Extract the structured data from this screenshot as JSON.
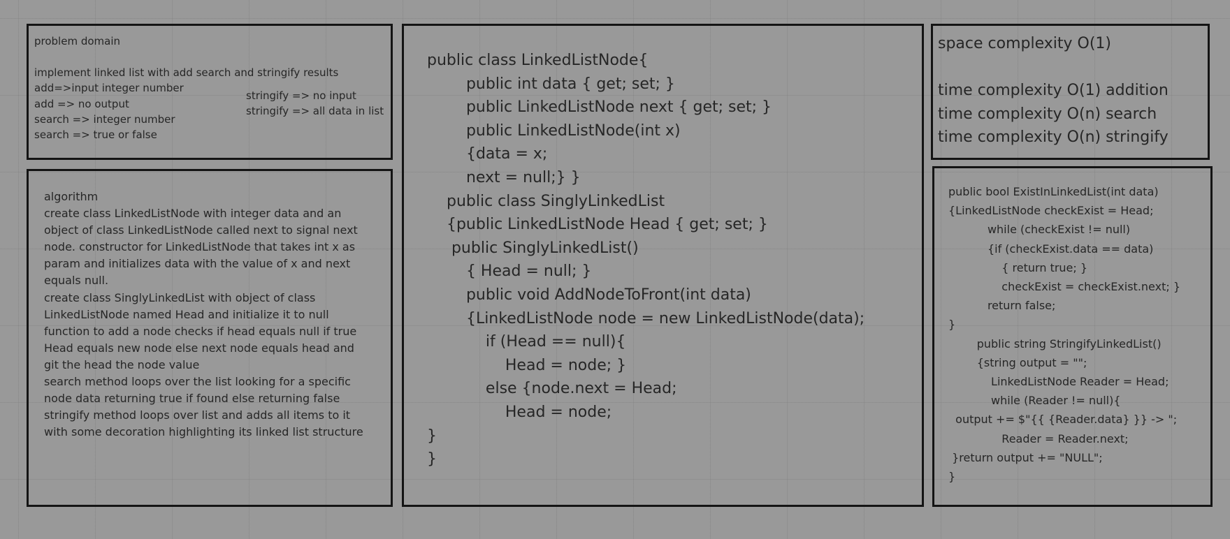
{
  "problem_domain": {
    "lines": [
      "problem domain",
      "",
      "implement linked list with add search and stringify results",
      "add=>input integer number",
      "add => no output",
      "search => integer number",
      "search => true or false"
    ],
    "right_lines": [
      "stringify => no input",
      "stringify => all data in list"
    ]
  },
  "algorithm": {
    "lines": [
      "algorithm",
      "create class LinkedListNode with integer data and an",
      "object of class LinkedListNode called next to signal next",
      "node. constructor for LinkedListNode that takes int x as",
      "param and initializes data with the value of x and next",
      "equals null.",
      "create class SinglyLinkedList with object of class",
      "LinkedListNode named Head and initialize it to null",
      "function to add a node checks if head equals null if true",
      "Head equals new node else next node equals head and",
      "git the head the node value",
      "search method loops over the list looking for a specific",
      "node data returning true if found else returning false",
      "stringify method loops over list and adds all items to it",
      "with some decoration highlighting its linked list structure"
    ]
  },
  "code": {
    "lines": [
      "public class LinkedListNode{",
      "        public int data { get; set; }",
      "        public LinkedListNode next { get; set; }",
      "        public LinkedListNode(int x)",
      "        {data = x;",
      "        next = null;} }",
      "    public class SinglyLinkedList",
      "    {public LinkedListNode Head { get; set; }",
      "     public SinglyLinkedList()",
      "        { Head = null; }",
      "        public void AddNodeToFront(int data)",
      "        {LinkedListNode node = new LinkedListNode(data);",
      "            if (Head == null){",
      "                Head = node; }",
      "            else {node.next = Head;",
      "                Head = node;",
      "}",
      "}"
    ]
  },
  "complexity": {
    "lines": [
      "space complexity O(1)",
      "",
      "time complexity O(1) addition",
      "time complexity O(n) search",
      "time complexity O(n) stringify"
    ]
  },
  "functions": {
    "lines": [
      "public bool ExistInLinkedList(int data)",
      "{LinkedListNode checkExist = Head;",
      "           while (checkExist != null)",
      "           {if (checkExist.data == data)",
      "               { return true; }",
      "               checkExist = checkExist.next; }",
      "           return false;",
      "}",
      "        public string StringifyLinkedList()",
      "        {string output = \"\";",
      "            LinkedListNode Reader = Head;",
      "            while (Reader != null){",
      "  output += $\"{{ {Reader.data} }} -> \";",
      "               Reader = Reader.next;",
      " }return output += \"NULL\";",
      "}"
    ]
  }
}
